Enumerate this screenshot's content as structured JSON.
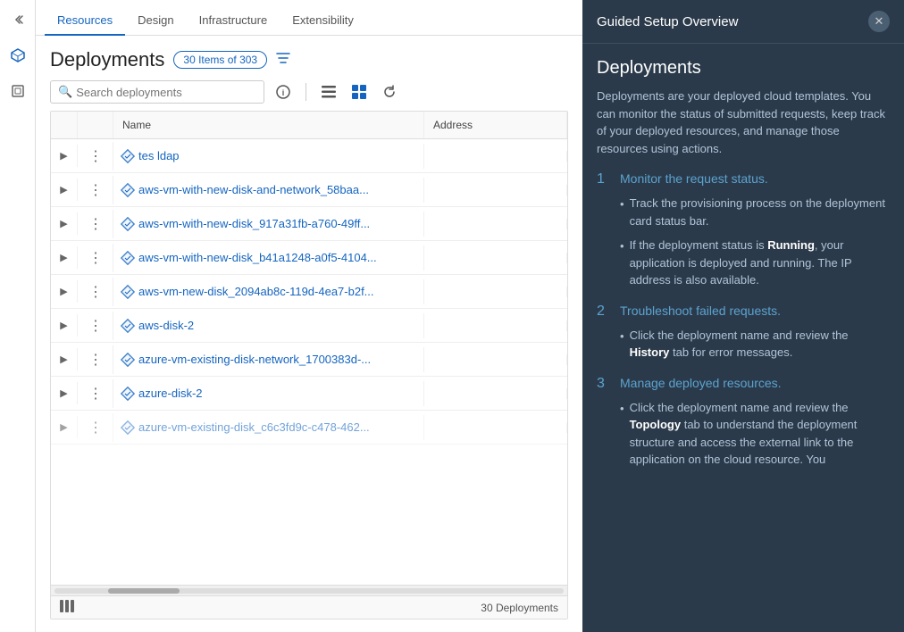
{
  "nav": {
    "tabs": [
      "Resources",
      "Design",
      "Infrastructure",
      "Extensibility"
    ]
  },
  "sidebar": {
    "icons": [
      "chevron-left",
      "diamond",
      "cube"
    ]
  },
  "page": {
    "title": "Deployments",
    "badge": "30 Items of 303",
    "search_placeholder": "Search deployments",
    "footer_count": "30 Deployments"
  },
  "table": {
    "columns": [
      "",
      "",
      "Name",
      "Address"
    ],
    "rows": [
      {
        "name": "tes ldap",
        "address": ""
      },
      {
        "name": "aws-vm-with-new-disk-and-network_58baa...",
        "address": ""
      },
      {
        "name": "aws-vm-with-new-disk_917a31fb-a760-49ff...",
        "address": ""
      },
      {
        "name": "aws-vm-with-new-disk_b41a1248-a0f5-4104...",
        "address": ""
      },
      {
        "name": "aws-vm-new-disk_2094ab8c-119d-4ea7-b2f...",
        "address": ""
      },
      {
        "name": "aws-disk-2",
        "address": ""
      },
      {
        "name": "azure-vm-existing-disk-network_1700383d-...",
        "address": ""
      },
      {
        "name": "azure-disk-2",
        "address": ""
      },
      {
        "name": "azure-vm-existing-disk_c6c3fd9c-c478-462...",
        "address": ""
      }
    ]
  },
  "guided_setup": {
    "title": "Guided Setup Overview",
    "section_title": "Deployments",
    "description": "Deployments are your deployed cloud templates. You can monitor the status of submitted requests, keep track of your deployed resources, and manage those resources using actions.",
    "steps": [
      {
        "number": "1",
        "title": "Monitor the request status.",
        "bullets": [
          "Track the provisioning process on the deployment card status bar.",
          "If the deployment status is Running, your application is deployed and running. The IP address is also available."
        ],
        "highlight_words": []
      },
      {
        "number": "2",
        "title": "Troubleshoot failed requests.",
        "bullets": [
          "Click the deployment name and review the History tab for error messages."
        ],
        "highlight_in": [
          "History"
        ]
      },
      {
        "number": "3",
        "title": "Manage deployed resources.",
        "bullets": [
          "Click the deployment name and review the Topology tab to understand the deployment structure and access the external link to the application on the cloud resource. You"
        ],
        "highlight_in": [
          "Topology"
        ]
      }
    ]
  }
}
